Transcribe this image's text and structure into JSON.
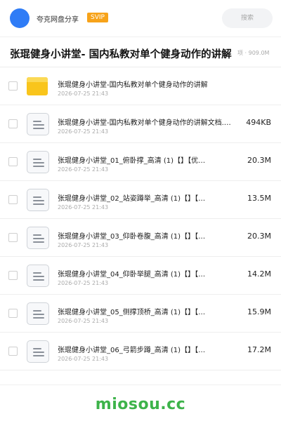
{
  "header": {
    "share_title": "夸克网盘分享",
    "svip_label": "SVIP",
    "search_placeholder": "搜索",
    "accent_color": "#2f7cf6"
  },
  "folder": {
    "title": "张琨健身小讲堂- 国内私教对单个健身动作的讲解",
    "meta": "项 · 909.0M"
  },
  "files": [
    {
      "type": "folder",
      "name": "张琨健身小讲堂-国内私教对单个健身动作的讲解",
      "date": "2026-07-25 21:43",
      "size": ""
    },
    {
      "type": "file",
      "name": "张琨健身小讲堂-国内私教对单个健身动作的讲解文档.…",
      "date": "2026-07-25 21:43",
      "size": "494KB"
    },
    {
      "type": "file",
      "name": "张琨健身小讲堂_01_俯卧撑_高清 (1)【】【优…",
      "date": "2026-07-25 21:43",
      "size": "20.3M"
    },
    {
      "type": "file",
      "name": "张琨健身小讲堂_02_站姿蹲举_高清 (1)【】【…",
      "date": "2026-07-25 21:43",
      "size": "13.5M"
    },
    {
      "type": "file",
      "name": "张琨健身小讲堂_03_仰卧卷腹_高清 (1)【】【…",
      "date": "2026-07-25 21:43",
      "size": "20.3M"
    },
    {
      "type": "file",
      "name": "张琨健身小讲堂_04_仰卧举腿_高清 (1)【】【…",
      "date": "2026-07-25 21:43",
      "size": "14.2M"
    },
    {
      "type": "file",
      "name": "张琨健身小讲堂_05_侧撑顶桥_高清 (1)【】【…",
      "date": "2026-07-25 21:43",
      "size": "15.9M"
    },
    {
      "type": "file",
      "name": "张琨健身小讲堂_06_弓箭步蹲_高清 (1)【】【…",
      "date": "2026-07-25 21:43",
      "size": "17.2M"
    }
  ],
  "footer": {
    "brand": "miosou.cc",
    "brand_color": "#3db34a"
  }
}
